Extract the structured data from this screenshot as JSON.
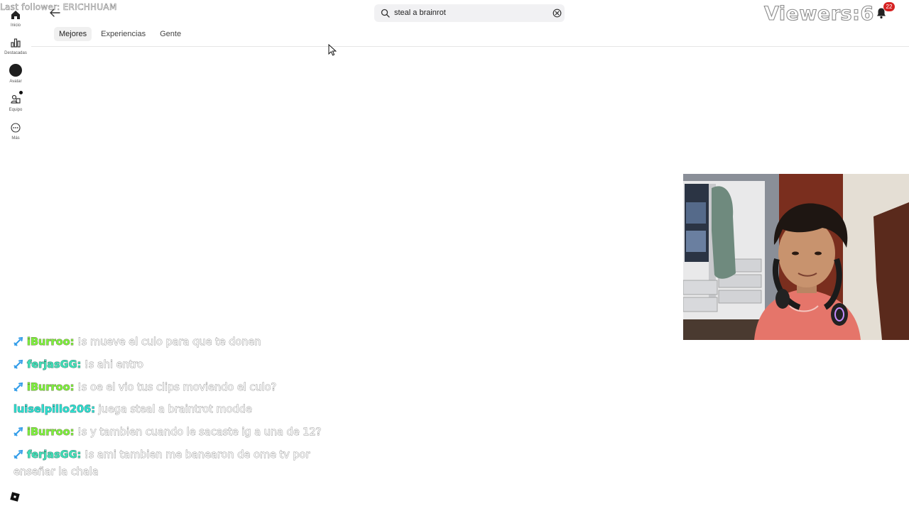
{
  "overlay": {
    "last_follower": "Last follower: ERICHHUAM",
    "viewers_label": "Viewers:",
    "viewers_count": "6",
    "notification_count": "22"
  },
  "sidebar": {
    "items": [
      {
        "label": "Inicio",
        "icon": "home-icon"
      },
      {
        "label": "Destacadas",
        "icon": "chart-icon"
      },
      {
        "label": "Avatar",
        "icon": "avatar-icon"
      },
      {
        "label": "Equipo",
        "icon": "team-icon"
      },
      {
        "label": "Más",
        "icon": "more-icon"
      }
    ]
  },
  "search": {
    "value": "steal a brainrot"
  },
  "tabs": [
    {
      "label": "Mejores",
      "active": true
    },
    {
      "label": "Experiencias",
      "active": false
    },
    {
      "label": "Gente",
      "active": false
    }
  ],
  "chat": {
    "messages": [
      {
        "user": "iBurroo:",
        "text": "!s mueve el culo para que te donen",
        "badge": true,
        "color": "green"
      },
      {
        "user": "ferjasGG:",
        "text": "!s ahi entro",
        "badge": true,
        "color": "teal"
      },
      {
        "user": "iBurroo:",
        "text": "!s oe el vio tus clips moviendo el culo?",
        "badge": true,
        "color": "green"
      },
      {
        "user": "luiselpillo206:",
        "text": "juega steal a braintrot modde",
        "badge": false,
        "color": "aqua"
      },
      {
        "user": "iBurroo:",
        "text": "!s y tambien cuando le sacaste ig a una de 12?",
        "badge": true,
        "color": "green"
      },
      {
        "user": "ferjasGG:",
        "text": "!s ami tambien me banearon de ome tv por enseñar la chala",
        "badge": true,
        "color": "teal"
      }
    ]
  },
  "colors": {
    "badge_blue": "#2f9be8",
    "notif_red": "#d62222",
    "user_green": "#7bf23c",
    "user_teal": "#3fe0b8"
  }
}
